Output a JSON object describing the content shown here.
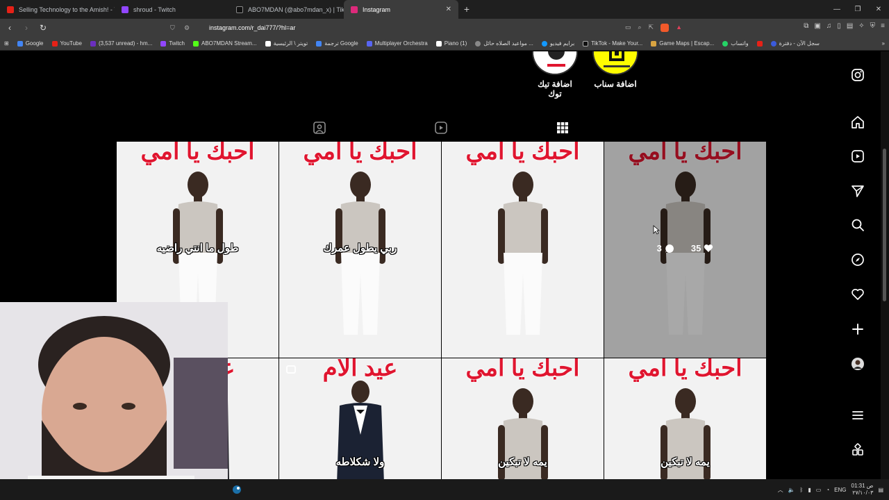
{
  "tabs": [
    {
      "title": "Selling Technology to the Amish! - Yo",
      "color": "#e62117"
    },
    {
      "title": "shroud - Twitch",
      "color": "#9146ff"
    },
    {
      "title": "ABO7MDAN (@abo7mdan_x) | TikTok",
      "color": "#111111"
    },
    {
      "title": "Instagram",
      "color": "#dd2a7b",
      "active": true
    }
  ],
  "tab_close": "✕",
  "new_tab": "+",
  "window": {
    "minimize": "—",
    "restore": "❐",
    "close": "✕"
  },
  "omnibox": {
    "url": "instagram.com/r_dai777/?hl=ar"
  },
  "bookmarks": [
    {
      "label": "Google",
      "color": "#4285f4"
    },
    {
      "label": "YouTube",
      "color": "#e62117"
    },
    {
      "label": "(3,537 unread) - hm...",
      "color": "#6b2fbf"
    },
    {
      "label": "Twitch",
      "color": "#9146ff"
    },
    {
      "label": "ABO7MDAN Stream...",
      "color": "#53fc18"
    },
    {
      "label": "تويتر \\ الرئيسية",
      "color": "#ffffff"
    },
    {
      "label": "ترجمة Google",
      "color": "#4285f4"
    },
    {
      "label": "Multiplayer Orchestra",
      "color": "#5865f2"
    },
    {
      "label": "Piano (1)",
      "color": "#ffffff"
    },
    {
      "label": "مواعيد الصلاه حائل ...",
      "color": "#888888"
    },
    {
      "label": "برايم فيديو",
      "color": "#1399ff"
    },
    {
      "label": "TikTok - Make Your...",
      "color": "#111111"
    },
    {
      "label": "Game Maps | Escap...",
      "color": "#d9a441"
    },
    {
      "label": "واتساب",
      "color": "#25d366"
    },
    {
      "label": "",
      "color": "#e62117"
    },
    {
      "label": "سجل الآن - دفترة",
      "color": "#3b5bdb"
    }
  ],
  "highlights": [
    {
      "label": "اضافة تيك توك"
    },
    {
      "label": "اضافة سناب"
    }
  ],
  "posts": [
    {
      "heading": "احبك يا امي",
      "caption": "طول ما انتي راضيه",
      "reel": false
    },
    {
      "heading": "احبك يا امي",
      "caption": "ربي يطول عمرك",
      "reel": false
    },
    {
      "heading": "احبك يا امي",
      "caption": "",
      "reel": false
    },
    {
      "heading": "احبك يا امي",
      "caption": "",
      "reel": false,
      "hover": true,
      "likes": "35",
      "comments": "3"
    },
    {
      "heading": "عيد الام",
      "caption": "",
      "reel": false
    },
    {
      "heading": "عيد الام",
      "caption": "ولا شكلاطه",
      "reel": true
    },
    {
      "heading": "احبك يا امي",
      "caption": "يمه لا تبكين",
      "reel": false
    },
    {
      "heading": "احبك يا امي",
      "caption": "يمه لا تبكين",
      "reel": false
    }
  ],
  "taskbar": {
    "lang": "ENG",
    "time": "01:31 ص",
    "date": "٢٧/١٠/٠٣"
  },
  "colors": {
    "heading_red": "#e0152f",
    "page_bg": "#000000"
  }
}
